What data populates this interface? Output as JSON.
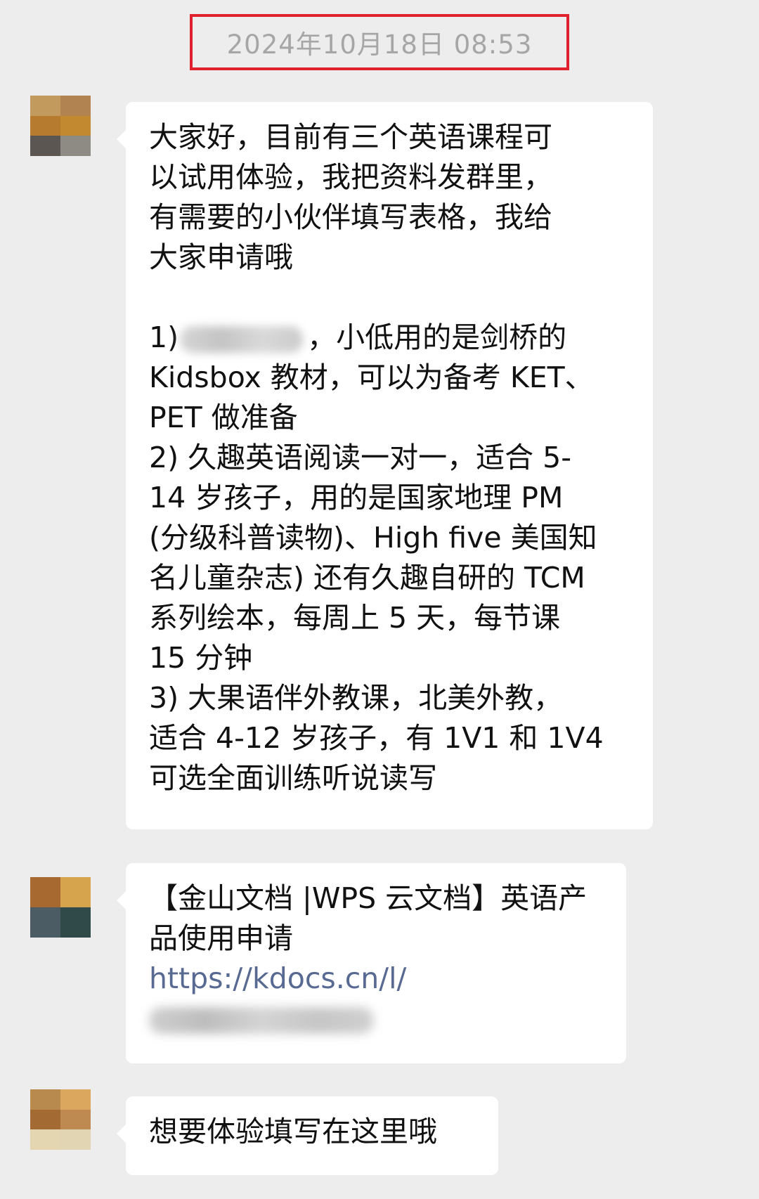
{
  "timestamp": "2024年10月18日 08:53",
  "colors": {
    "background": "#ededed",
    "bubble": "#ffffff",
    "timestamp_text": "#a6a6a6",
    "highlight_box": "#e0202c",
    "link": "#586a92"
  },
  "messages": [
    {
      "avatar": {
        "cells": [
          "#c39a5e",
          "#b08351",
          "#b67b2f",
          "#c28931",
          "#5b5652",
          "#8e8a84"
        ]
      },
      "lines": [
        "大家好，目前有三个英语课程可",
        "以试用体验，我把资料发群里，",
        "有需要的小伙伴填写表格，我给",
        "大家申请哦",
        "",
        "1)",
        "Kidsbox 教材，可以为备考 KET、",
        "PET 做准备",
        "2) 久趣英语阅读一对一，适合 5-",
        "14 岁孩子，用的是国家地理 PM",
        "(分级科普读物)、High five 美国知",
        "名儿童杂志) 还有久趣自研的 TCM",
        "系列绘本，每周上 5 天，每节课",
        "15 分钟",
        "3) 大果语伴外教课，北美外教，",
        "适合 4-12 岁孩子，有 1V1 和 1V4",
        "可选全面训练听说读写"
      ],
      "line6_suffix": "，小低用的是剑桥的"
    },
    {
      "avatar": {
        "cells": [
          "#a7692f",
          "#d5a44c",
          "#4b5c64",
          "#2f4a49"
        ]
      },
      "lines": [
        "【金山文档 |WPS 云文档】英语产",
        "品使用申请"
      ],
      "link": "https://kdocs.cn/l/"
    },
    {
      "avatar": {
        "cells": [
          "#b88a4e",
          "#dba65e",
          "#a46a34",
          "#bf8a52",
          "#e4d6b0",
          "#e2d5b4"
        ]
      },
      "lines": [
        "想要体验填写在这里哦"
      ]
    }
  ]
}
